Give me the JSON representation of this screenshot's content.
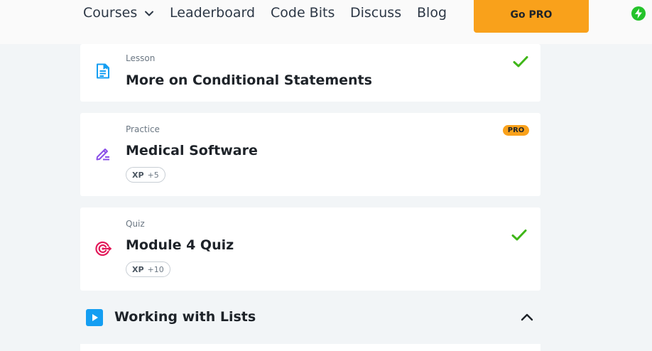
{
  "nav": {
    "courses": "Courses",
    "leaderboard": "Leaderboard",
    "code_bits": "Code Bits",
    "discuss": "Discuss",
    "blog": "Blog",
    "go_pro": "Go PRO"
  },
  "lessons": [
    {
      "type": "Lesson",
      "title": "More on Conditional Statements",
      "icon": "document-icon",
      "completed": true
    },
    {
      "type": "Practice",
      "title": "Medical Software",
      "icon": "pencil-edit-icon",
      "badge": "PRO",
      "xp_label": "XP",
      "xp_value": "+5",
      "completed": false
    },
    {
      "type": "Quiz",
      "title": "Module 4 Quiz",
      "icon": "target-icon",
      "xp_label": "XP",
      "xp_value": "+10",
      "completed": true
    }
  ],
  "section": {
    "title": "Working with Lists",
    "icon": "play-icon",
    "expanded": true
  },
  "colors": {
    "accent_orange": "#f9a11b",
    "check_green": "#3fb618",
    "lesson_blue": "#149ef2",
    "practice_purple": "#8a4fe8",
    "quiz_red": "#e21a5a"
  }
}
